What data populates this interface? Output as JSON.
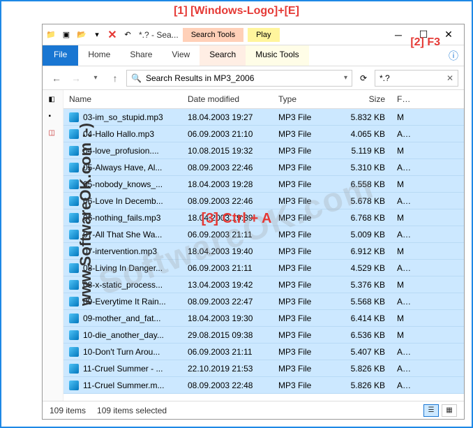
{
  "annotations": {
    "a1": "[1]  [Windows-Logo]+[E]",
    "a2": "[2] F3",
    "a3": "[3] Ctrl + A"
  },
  "watermark": {
    "side": "www.SoftwareOK.com :-)",
    "diag": "SoftwareOK.com"
  },
  "titlebar": {
    "title": "*.? - Sea...",
    "context1": "Search Tools",
    "context2": "Play"
  },
  "ribbon": {
    "file": "File",
    "tabs": [
      "Home",
      "Share",
      "View"
    ],
    "context1": "Search",
    "context2": "Music Tools"
  },
  "nav": {
    "address": "Search Results in MP3_2006",
    "search_value": "*.?"
  },
  "columns": {
    "name": "Name",
    "date": "Date modified",
    "type": "Type",
    "size": "Size",
    "fc": "Fc"
  },
  "files": [
    {
      "name": "03-im_so_stupid.mp3",
      "date": "18.04.2003 19:27",
      "type": "MP3 File",
      "size": "5.832 KB",
      "fc": "M"
    },
    {
      "name": "04-Hallo Hallo.mp3",
      "date": "06.09.2003 21:10",
      "type": "MP3 File",
      "size": "4.065 KB",
      "fc": "Ac"
    },
    {
      "name": "04-love_profusion....",
      "date": "10.08.2015 19:32",
      "type": "MP3 File",
      "size": "5.119 KB",
      "fc": "M"
    },
    {
      "name": "05-Always Have, Al...",
      "date": "08.09.2003 22:46",
      "type": "MP3 File",
      "size": "5.310 KB",
      "fc": "Ac"
    },
    {
      "name": "05-nobody_knows_...",
      "date": "18.04.2003 19:28",
      "type": "MP3 File",
      "size": "6.558 KB",
      "fc": "M"
    },
    {
      "name": "06-Love In Decemb...",
      "date": "08.09.2003 22:46",
      "type": "MP3 File",
      "size": "5.678 KB",
      "fc": "Ac"
    },
    {
      "name": "06-nothing_fails.mp3",
      "date": "18.04.2003 19:39",
      "type": "MP3 File",
      "size": "6.768 KB",
      "fc": "M"
    },
    {
      "name": "07-All That She Wa...",
      "date": "06.09.2003 21:11",
      "type": "MP3 File",
      "size": "5.009 KB",
      "fc": "Ac"
    },
    {
      "name": "07-intervention.mp3",
      "date": "18.04.2003 19:40",
      "type": "MP3 File",
      "size": "6.912 KB",
      "fc": "M"
    },
    {
      "name": "08-Living In Danger...",
      "date": "06.09.2003 21:11",
      "type": "MP3 File",
      "size": "4.529 KB",
      "fc": "Ac"
    },
    {
      "name": "08-x-static_process...",
      "date": "13.04.2003 19:42",
      "type": "MP3 File",
      "size": "5.376 KB",
      "fc": "M"
    },
    {
      "name": "09-Everytime It Rain...",
      "date": "08.09.2003 22:47",
      "type": "MP3 File",
      "size": "5.568 KB",
      "fc": "Ac"
    },
    {
      "name": "09-mother_and_fat...",
      "date": "18.04.2003 19:30",
      "type": "MP3 File",
      "size": "6.414 KB",
      "fc": "M"
    },
    {
      "name": "10-die_another_day...",
      "date": "29.08.2015 09:38",
      "type": "MP3 File",
      "size": "6.536 KB",
      "fc": "M"
    },
    {
      "name": "10-Don't Turn Arou...",
      "date": "06.09.2003 21:11",
      "type": "MP3 File",
      "size": "5.407 KB",
      "fc": "Ac"
    },
    {
      "name": "11-Cruel Summer - ...",
      "date": "22.10.2019 21:53",
      "type": "MP3 File",
      "size": "5.826 KB",
      "fc": "Ac"
    },
    {
      "name": "11-Cruel Summer.m...",
      "date": "08.09.2003 22:48",
      "type": "MP3 File",
      "size": "5.826 KB",
      "fc": "Ac"
    }
  ],
  "status": {
    "count": "109 items",
    "selected": "109 items selected"
  }
}
